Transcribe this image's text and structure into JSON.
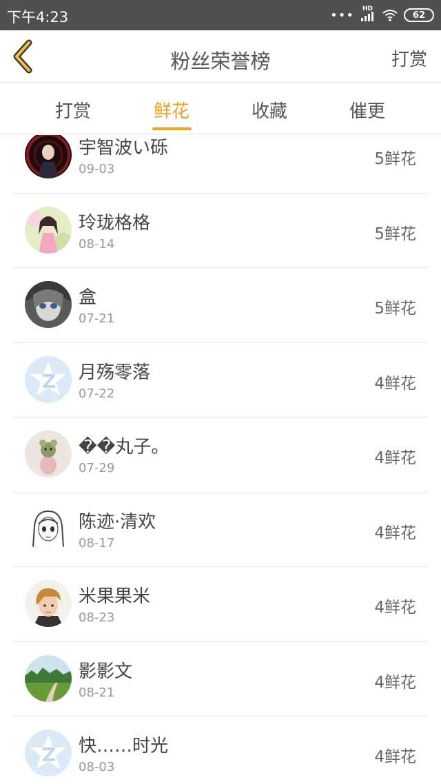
{
  "status_bar": {
    "time": "下午4:23",
    "battery": "62",
    "network": "HD"
  },
  "nav": {
    "title": "粉丝荣誉榜",
    "action_label": "打赏"
  },
  "tabs": [
    {
      "label": "打赏",
      "active": false
    },
    {
      "label": "鲜花",
      "active": true
    },
    {
      "label": "收藏",
      "active": false
    },
    {
      "label": "催更",
      "active": false
    }
  ],
  "colors": {
    "accent": "#f0a020",
    "status_bar": "#505050"
  },
  "fans": [
    {
      "name": "宇智波い砾",
      "date": "09-03",
      "amount": "5鲜花",
      "avatar": "anime-dark-avatar"
    },
    {
      "name": "玲珑格格",
      "date": "08-14",
      "amount": "5鲜花",
      "avatar": "anime-girl-avatar"
    },
    {
      "name": "盒",
      "date": "07-21",
      "amount": "5鲜花",
      "avatar": "anime-grey-avatar"
    },
    {
      "name": "月殇零落",
      "date": "07-22",
      "amount": "4鲜花",
      "avatar": "default-star-avatar"
    },
    {
      "name": "��丸子。",
      "date": "07-29",
      "amount": "4鲜花",
      "avatar": "plush-toy-avatar"
    },
    {
      "name": "陈迹·清欢",
      "date": "08-17",
      "amount": "4鲜花",
      "avatar": "sketch-girl-avatar"
    },
    {
      "name": "米果果米",
      "date": "08-23",
      "amount": "4鲜花",
      "avatar": "person-photo-avatar"
    },
    {
      "name": "影影文",
      "date": "08-21",
      "amount": "4鲜花",
      "avatar": "landscape-avatar"
    },
    {
      "name": "快……时光",
      "date": "08-03",
      "amount": "4鲜花",
      "avatar": "default-star-avatar"
    }
  ]
}
